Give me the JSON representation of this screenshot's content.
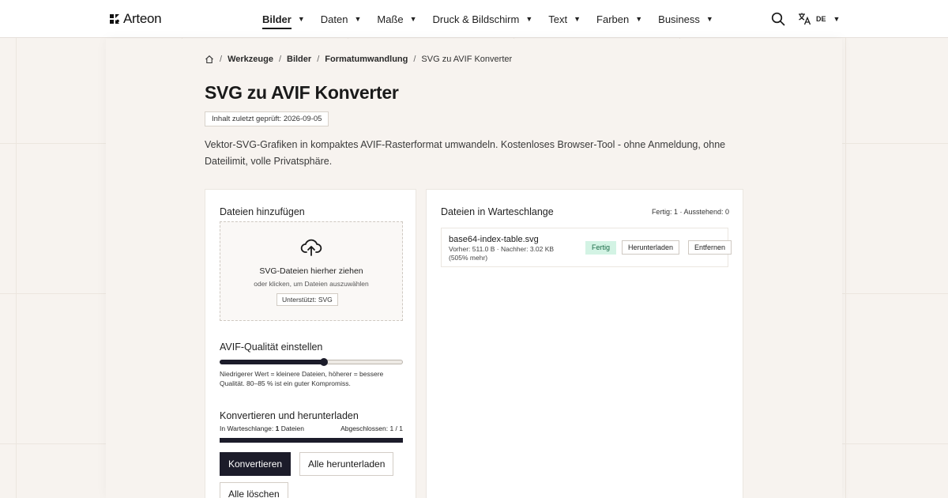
{
  "brand": {
    "name": "Arteon"
  },
  "nav": {
    "items": [
      {
        "label": "Bilder",
        "active": true
      },
      {
        "label": "Daten"
      },
      {
        "label": "Maße"
      },
      {
        "label": "Druck & Bildschirm"
      },
      {
        "label": "Text"
      },
      {
        "label": "Farben"
      },
      {
        "label": "Business"
      }
    ],
    "caret": "▼"
  },
  "language": {
    "code": "DE"
  },
  "breadcrumb": {
    "sep": "/",
    "items": [
      "Werkzeuge",
      "Bilder",
      "Formatumwandlung"
    ],
    "current": "SVG zu AVIF Konverter"
  },
  "page": {
    "title": "SVG zu AVIF Konverter",
    "reviewed": "Inhalt zuletzt geprüft: 2026-09-05",
    "intro": "Vektor-SVG-Grafiken in kompaktes AVIF-Rasterformat umwandeln. Kostenloses Browser-Tool - ohne Anmeldung, ohne Dateilimit, volle Privatsphäre."
  },
  "upload": {
    "title": "Dateien hinzufügen",
    "drop_title": "SVG-Dateien hierher ziehen",
    "drop_sub": "oder klicken, um Dateien auszuwählen",
    "supported": "Unterstützt: SVG"
  },
  "quality": {
    "title": "AVIF-Qualität einstellen",
    "value": 0.57,
    "hint": "Niedrigerer Wert = kleinere Dateien, höherer = bessere Qualität. 80–85 % ist ein guter Kompromiss."
  },
  "convert": {
    "title": "Konvertieren und herunterladen",
    "queued_label": "In Warteschlange:",
    "queued_count": "1",
    "queued_unit": "Dateien",
    "completed": "Abgeschlossen: 1 / 1",
    "progress": 1.0,
    "convert_button": "Konvertieren",
    "download_all_button": "Alle herunterladen",
    "clear_all_button": "Alle löschen"
  },
  "queue": {
    "title": "Dateien in Warteschlange",
    "counts": "Fertig: 1 · Ausstehend: 0",
    "files": [
      {
        "name": "base64-index-table.svg",
        "meta": "Vorher: 511.0 B · Nachher: 3.02 KB (505% mehr)",
        "status": "Fertig",
        "download_label": "Herunterladen",
        "remove_label": "Entfernen"
      }
    ]
  },
  "colors": {
    "accent": "#1c1c2a",
    "success_bg": "#d3f3e4",
    "success_text": "#1c6b48"
  }
}
